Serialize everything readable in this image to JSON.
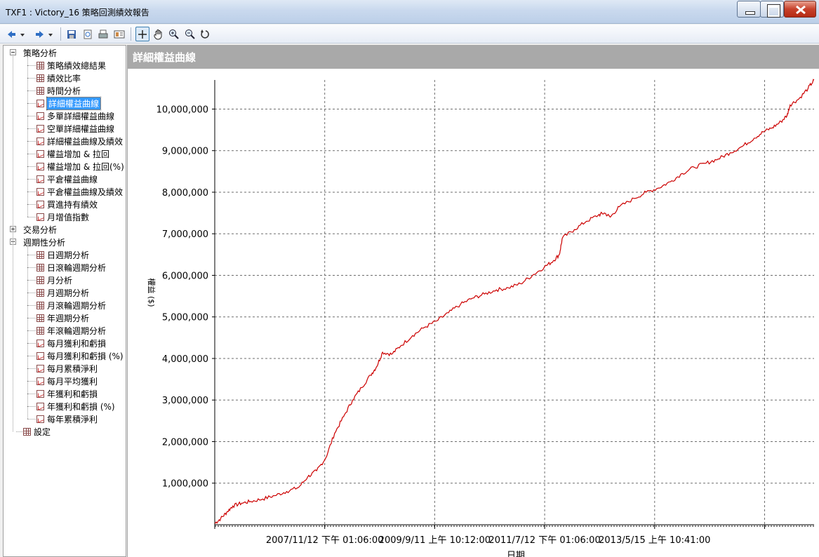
{
  "window": {
    "title": "TXF1 : Victory_16 策略回測績效報告"
  },
  "toolbar": {
    "icons": [
      "back-icon",
      "forward-icon",
      "save-icon",
      "preview-icon",
      "print-icon",
      "report-icon",
      "select-cursor-icon",
      "pan-hand-icon",
      "zoom-in-icon",
      "zoom-out-icon",
      "reset-zoom-icon"
    ]
  },
  "tree": {
    "strategy": {
      "label": "策略分析",
      "items": [
        "策略績效總結果",
        "績效比率",
        "時間分析",
        "詳細權益曲線",
        "多單詳細權益曲線",
        "空單詳細權益曲線",
        "詳細權益曲線及績效",
        "權益增加 & 拉回",
        "權益增加 & 拉回(%)",
        "平倉權益曲線",
        "平倉權益曲線及績效",
        "買進持有績效",
        "月增值指數"
      ]
    },
    "trade": {
      "label": "交易分析"
    },
    "period": {
      "label": "週期性分析",
      "items": [
        "日週期分析",
        "日滾輪週期分析",
        "月分析",
        "月週期分析",
        "月滾輪週期分析",
        "年週期分析",
        "年滾輪週期分析",
        "每月獲利和虧損",
        "每月獲利和虧損 (%)",
        "每月累積淨利",
        "每月平均獲利",
        "年獲利和虧損",
        "年獲利和虧損 (%)",
        "每年累積淨利"
      ]
    },
    "settings": {
      "label": "設定"
    }
  },
  "panel": {
    "title": "詳細權益曲線"
  },
  "chart_data": {
    "type": "line",
    "title": "詳細權益曲線",
    "ylabel": "權益 ($)",
    "xlabel": "日期",
    "ylim": [
      0,
      10700000
    ],
    "yticks": [
      1000000,
      2000000,
      3000000,
      4000000,
      5000000,
      6000000,
      7000000,
      8000000,
      9000000,
      10000000
    ],
    "ytick_labels": [
      "1,000,000",
      "2,000,000",
      "3,000,000",
      "4,000,000",
      "5,000,000",
      "6,000,000",
      "7,000,000",
      "8,000,000",
      "9,000,000",
      "10,000,000"
    ],
    "xtick_labels": [
      "2007/11/12 下午 01:06:00",
      "2009/9/11 上午 10:12:00",
      "2011/7/12 下午 01:06:00",
      "2013/5/15 上午 10:41:00"
    ],
    "grid": true,
    "line_color": "#cc0000",
    "series": [
      {
        "points": [
          [
            0.0,
            30000
          ],
          [
            0.01,
            150000
          ],
          [
            0.02,
            300000
          ],
          [
            0.03,
            450000
          ],
          [
            0.045,
            520000
          ],
          [
            0.06,
            560000
          ],
          [
            0.08,
            620000
          ],
          [
            0.1,
            700000
          ],
          [
            0.12,
            800000
          ],
          [
            0.14,
            900000
          ],
          [
            0.155,
            1150000
          ],
          [
            0.17,
            1300000
          ],
          [
            0.185,
            1600000
          ],
          [
            0.2,
            2200000
          ],
          [
            0.215,
            2600000
          ],
          [
            0.23,
            3000000
          ],
          [
            0.245,
            3300000
          ],
          [
            0.26,
            3600000
          ],
          [
            0.27,
            3800000
          ],
          [
            0.28,
            4150000
          ],
          [
            0.295,
            4100000
          ],
          [
            0.31,
            4300000
          ],
          [
            0.33,
            4550000
          ],
          [
            0.35,
            4750000
          ],
          [
            0.37,
            4900000
          ],
          [
            0.39,
            5100000
          ],
          [
            0.41,
            5300000
          ],
          [
            0.43,
            5450000
          ],
          [
            0.45,
            5550000
          ],
          [
            0.47,
            5650000
          ],
          [
            0.49,
            5700000
          ],
          [
            0.51,
            5800000
          ],
          [
            0.53,
            6000000
          ],
          [
            0.55,
            6200000
          ],
          [
            0.565,
            6350000
          ],
          [
            0.575,
            6500000
          ],
          [
            0.58,
            6900000
          ],
          [
            0.6,
            7100000
          ],
          [
            0.62,
            7300000
          ],
          [
            0.64,
            7450000
          ],
          [
            0.65,
            7500000
          ],
          [
            0.66,
            7400000
          ],
          [
            0.675,
            7650000
          ],
          [
            0.7,
            7850000
          ],
          [
            0.72,
            8000000
          ],
          [
            0.74,
            8100000
          ],
          [
            0.76,
            8250000
          ],
          [
            0.78,
            8450000
          ],
          [
            0.8,
            8600000
          ],
          [
            0.82,
            8700000
          ],
          [
            0.84,
            8800000
          ],
          [
            0.86,
            8950000
          ],
          [
            0.88,
            9100000
          ],
          [
            0.9,
            9300000
          ],
          [
            0.915,
            9450000
          ],
          [
            0.93,
            9550000
          ],
          [
            0.945,
            9700000
          ],
          [
            0.955,
            9850000
          ],
          [
            0.96,
            10100000
          ],
          [
            0.975,
            10250000
          ],
          [
            0.99,
            10500000
          ],
          [
            1.0,
            10700000
          ]
        ]
      }
    ]
  }
}
